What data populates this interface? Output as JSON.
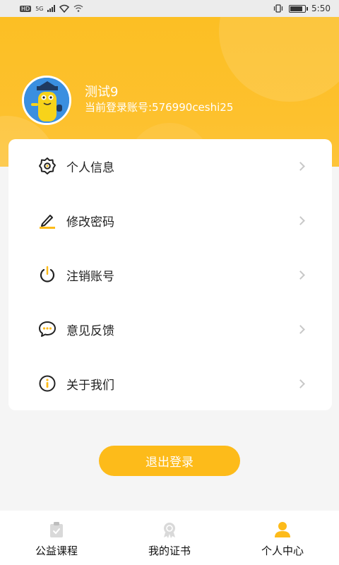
{
  "status_bar": {
    "hd_tag": "HD",
    "net_tag": "5G",
    "time": "5:50"
  },
  "user": {
    "name": "测试9",
    "account": "当前登录账号:576990ceshi25"
  },
  "menu": {
    "items": [
      {
        "label": "个人信息",
        "icon": "gear-icon"
      },
      {
        "label": "修改密码",
        "icon": "pencil-icon"
      },
      {
        "label": "注销账号",
        "icon": "power-icon"
      },
      {
        "label": "意见反馈",
        "icon": "chat-bubble-icon"
      },
      {
        "label": "关于我们",
        "icon": "info-icon"
      }
    ]
  },
  "logout_label": "退出登录",
  "tab_bar": {
    "tabs": [
      {
        "label": "公益课程",
        "icon": "clipboard-icon",
        "active": false
      },
      {
        "label": "我的证书",
        "icon": "badge-icon",
        "active": false
      },
      {
        "label": "个人中心",
        "icon": "person-icon",
        "active": true
      }
    ]
  },
  "colors": {
    "primary": "#fdbb1a",
    "header": "#fcbf24",
    "inactive_icon": "#d9d9d9"
  }
}
